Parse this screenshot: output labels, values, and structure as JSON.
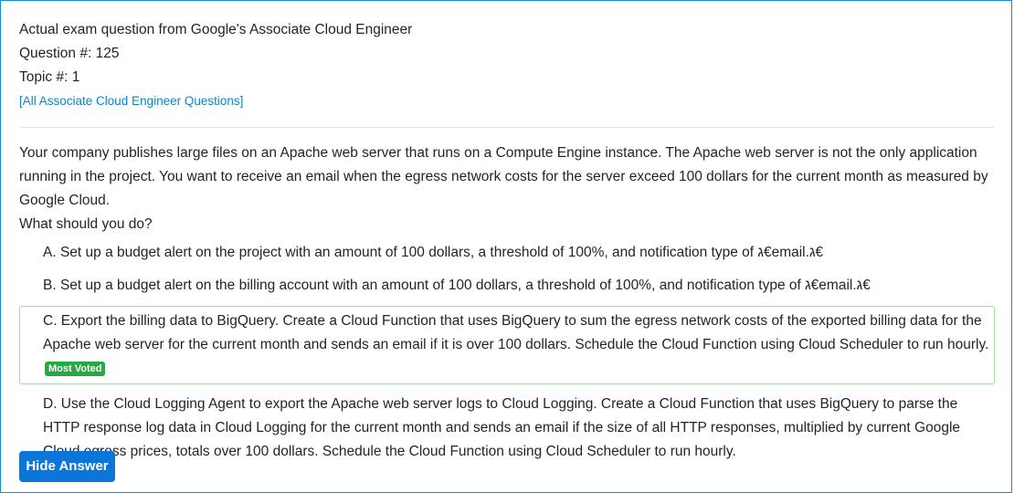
{
  "header": {
    "title": "Actual exam question from Google's Associate Cloud Engineer",
    "question_number": "Question #: 125",
    "topic": "Topic #: 1",
    "all_questions_link": "[All Associate Cloud Engineer Questions]"
  },
  "question": {
    "body": "Your company publishes large files on an Apache web server that runs on a Compute Engine instance. The Apache web server is not the only application running in the project. You want to receive an email when the egress network costs for the server exceed 100 dollars for the current month as measured by Google Cloud.",
    "prompt": "What should you do?"
  },
  "choices": [
    {
      "text": "A. Set up a budget alert on the project with an amount of 100 dollars, a threshold of 100%, and notification type of ג€email.ג€"
    },
    {
      "text": "B. Set up a budget alert on the billing account with an amount of 100 dollars, a threshold of 100%, and notification type of ג€email.ג€"
    },
    {
      "text": "C. Export the billing data to BigQuery. Create a Cloud Function that uses BigQuery to sum the egress network costs of the exported billing data for the Apache web server for the current month and sends an email if it is over 100 dollars. Schedule the Cloud Function using Cloud Scheduler to run hourly.",
      "badge": "Most Voted"
    },
    {
      "text": "D. Use the Cloud Logging Agent to export the Apache web server logs to Cloud Logging. Create a Cloud Function that uses BigQuery to parse the HTTP response log data in Cloud Logging for the current month and sends an email if the size of all HTTP responses, multiplied by current Google Cloud egress prices, totals over 100 dollars. Schedule the Cloud Function using Cloud Scheduler to run hourly."
    }
  ],
  "actions": {
    "hide_answer_label": "Hide Answer"
  },
  "colors": {
    "accent": "#0b76d9",
    "link": "#0b86c9",
    "voted_border": "#a6d8a3",
    "badge": "#28a745"
  }
}
